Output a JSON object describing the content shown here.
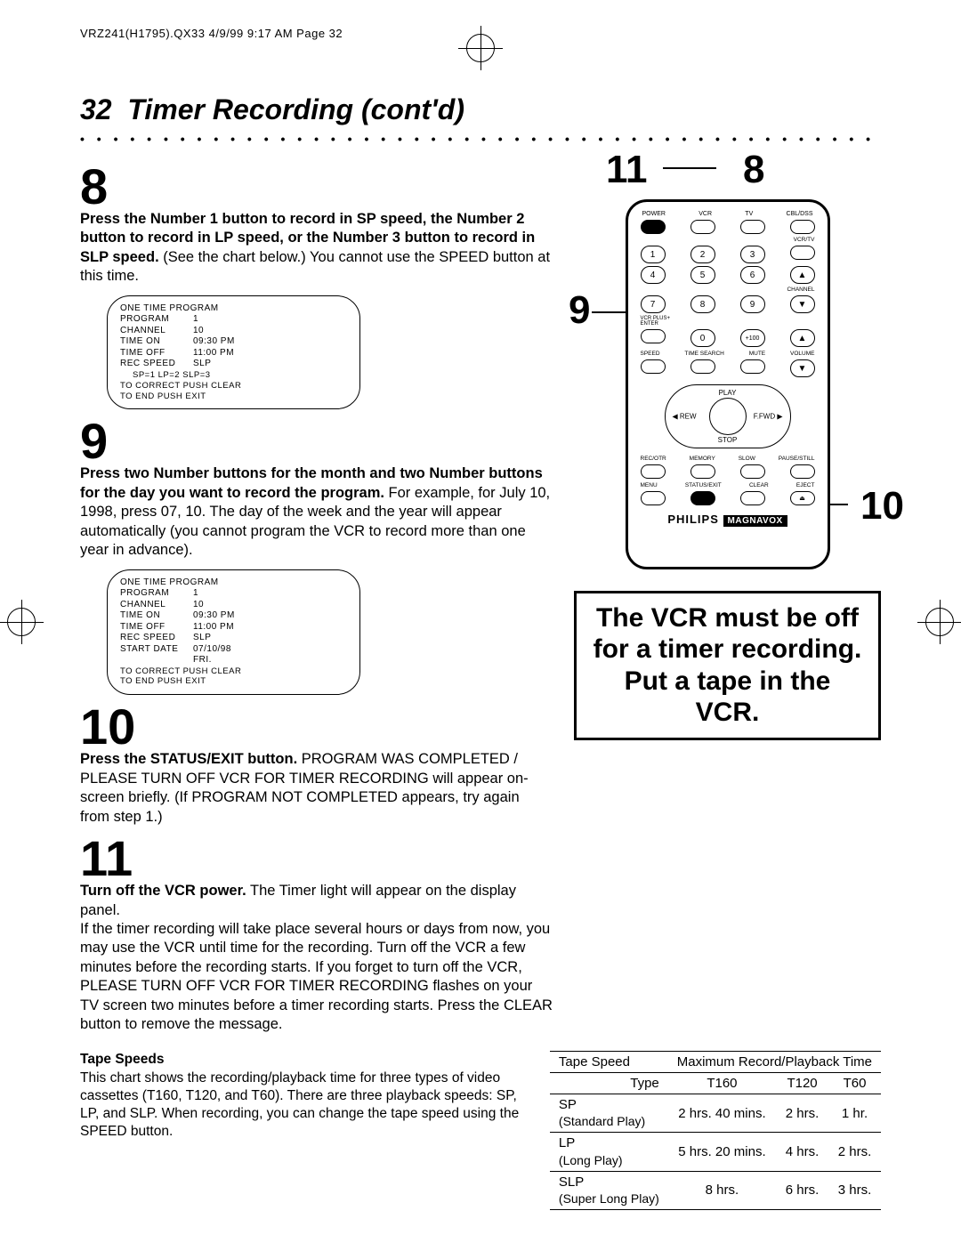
{
  "header_line": "VRZ241(H1795).QX33  4/9/99 9:17 AM  Page 32",
  "page_number": "32",
  "page_title": "Timer Recording (cont'd)",
  "steps": {
    "s8": {
      "num": "8",
      "bold": "Press the Number 1 button to record in SP speed, the Number 2 button to record in LP speed, or the Number 3 button to record in SLP speed.",
      "rest": " (See the chart below.) You cannot use the SPEED button at this time."
    },
    "s9": {
      "num": "9",
      "bold": "Press two Number buttons for the month and two Number buttons for the day you want to record the program.",
      "rest": " For example, for July 10, 1998, press 07, 10. The day of the week and the year will appear automatically (you cannot program the VCR to record more than one year in advance)."
    },
    "s10": {
      "num": "10",
      "bold": "Press the STATUS/EXIT button.",
      "rest": " PROGRAM WAS COMPLETED / PLEASE TURN OFF VCR FOR TIMER RECORDING will appear on-screen briefly. (If PROGRAM NOT COMPLETED appears, try again from step 1.)"
    },
    "s11": {
      "num": "11",
      "bold": "Turn off the VCR power.",
      "rest1": " The Timer light will appear on the display panel.",
      "rest2": "If the timer recording will take place several hours or days from now, you may use the VCR until time for the recording. Turn off the VCR a few minutes before the recording starts. If you forget to turn off the VCR, PLEASE TURN OFF VCR FOR TIMER RECORDING flashes on your TV screen two minutes before a timer recording starts. Press the CLEAR button to remove the message."
    }
  },
  "osd1": {
    "title": "ONE TIME PROGRAM",
    "program_k": "PROGRAM",
    "program_v": "1",
    "channel_k": "CHANNEL",
    "channel_v": "10",
    "timeon_k": "TIME ON",
    "timeon_v": "09:30 PM",
    "timeoff_k": "TIME OFF",
    "timeoff_v": "11:00 PM",
    "rec_k": "REC SPEED",
    "rec_v": "SLP",
    "hint1": "SP=1   LP=2   SLP=3",
    "hint2": "TO CORRECT PUSH CLEAR",
    "hint3": "TO END PUSH EXIT"
  },
  "osd2": {
    "title": "ONE TIME PROGRAM",
    "program_k": "PROGRAM",
    "program_v": "1",
    "channel_k": "CHANNEL",
    "channel_v": "10",
    "timeon_k": "TIME ON",
    "timeon_v": "09:30 PM",
    "timeoff_k": "TIME OFF",
    "timeoff_v": "11:00 PM",
    "rec_k": "REC SPEED",
    "rec_v": "SLP",
    "start_k": "START DATE",
    "start_v": "07/10/98",
    "day": "FRI.",
    "hint2": "TO CORRECT PUSH CLEAR",
    "hint3": "TO END PUSH EXIT"
  },
  "callouts": {
    "c11": "11",
    "c8": "8",
    "c9": "9",
    "c10": "10"
  },
  "remote": {
    "dev1": "POWER",
    "dev2": "VCR",
    "dev3": "TV",
    "dev4": "CBL/DSS",
    "vcrtv": "VCR/TV",
    "n1": "1",
    "n2": "2",
    "n3": "3",
    "n4": "4",
    "n5": "5",
    "n6": "6",
    "n7": "7",
    "n8": "8",
    "n9": "9",
    "n0": "0",
    "n100": "+100",
    "channel": "CHANNEL",
    "vcrplus": "VCR PLUS+\nENTER",
    "l_speed": "SPEED",
    "l_time": "TIME SEARCH",
    "l_mute": "MUTE",
    "l_volume": "VOLUME",
    "p_play": "PLAY",
    "p_stop": "STOP",
    "p_rew": "REW",
    "p_ffwd": "F.FWD",
    "r1a": "REC/OTR",
    "r1b": "MEMORY",
    "r1c": "SLOW",
    "r1d": "PAUSE/STILL",
    "r2a": "MENU",
    "r2b": "STATUS/EXIT",
    "r2c": "CLEAR",
    "r2d": "EJECT",
    "brand1": "PHILIPS",
    "brand2": "MAGNAVOX"
  },
  "notice": "The VCR must be off for a timer recording. Put a tape in the VCR.",
  "tape_speeds": {
    "heading": "Tape Speeds",
    "desc": "This chart shows the recording/playback time for three types of video cassettes (T160, T120, and T60). There are three playback speeds: SP, LP, and SLP. When recording, you can change the tape speed using the SPEED button."
  },
  "chart_data": {
    "type": "table",
    "title": "Tape Speed — Maximum Record/Playback Time",
    "col_headers": [
      "Tape Speed",
      "Maximum Record/Playback Time"
    ],
    "sub_headers": [
      "Type",
      "T160",
      "T120",
      "T60"
    ],
    "rows": [
      {
        "type": "SP",
        "type_sub": "(Standard Play)",
        "t160": "2 hrs. 40 mins.",
        "t120": "2 hrs.",
        "t60": "1 hr."
      },
      {
        "type": "LP",
        "type_sub": "(Long Play)",
        "t160": "5 hrs. 20 mins.",
        "t120": "4 hrs.",
        "t60": "2 hrs."
      },
      {
        "type": "SLP",
        "type_sub": "(Super Long Play)",
        "t160": "8 hrs.",
        "t120": "6 hrs.",
        "t60": "3 hrs."
      }
    ]
  }
}
